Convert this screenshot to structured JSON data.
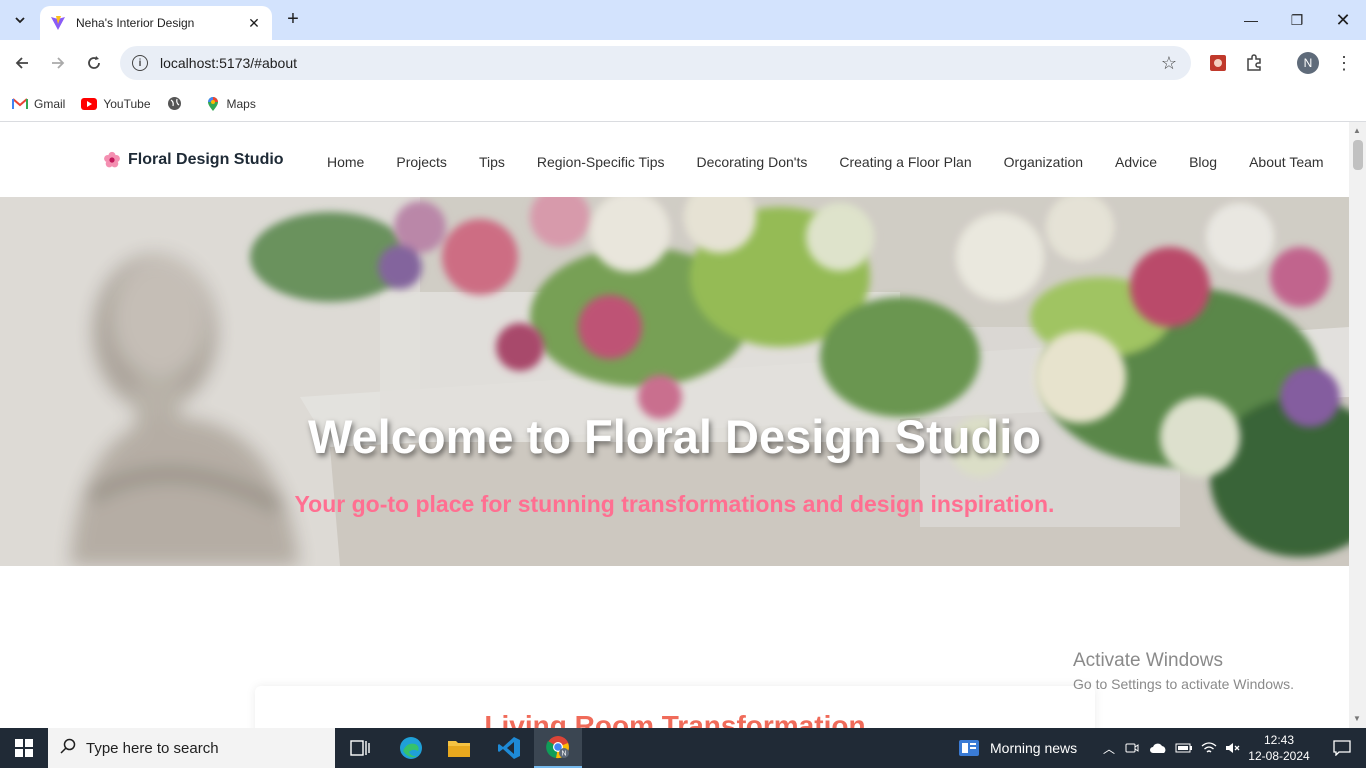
{
  "browser": {
    "tab_title": "Neha's Interior Design",
    "url": "localhost:5173/#about",
    "profile_initial": "N",
    "bookmarks": [
      {
        "label": "Gmail",
        "icon": "gmail-icon"
      },
      {
        "label": "YouTube",
        "icon": "youtube-icon"
      },
      {
        "label": "",
        "icon": "globe-icon"
      },
      {
        "label": "Maps",
        "icon": "maps-icon"
      }
    ]
  },
  "site": {
    "brand": "Floral Design Studio",
    "nav": [
      "Home",
      "Projects",
      "Tips",
      "Region-Specific Tips",
      "Decorating Don'ts",
      "Creating a Floor Plan",
      "Organization",
      "Advice",
      "Blog",
      "About Team"
    ],
    "hero_title": "Welcome to Floral Design Studio",
    "hero_subtitle": "Your go-to place for stunning transformations and design inspiration.",
    "card_title": "Living Room Transformation"
  },
  "watermark": {
    "line1": "Activate Windows",
    "line2": "Go to Settings to activate Windows."
  },
  "taskbar": {
    "search_placeholder": "Type here to search",
    "news": "Morning news",
    "time": "12:43",
    "date": "12-08-2024"
  },
  "colors": {
    "accent_pink": "#ff6f91",
    "card_title": "#f06b5a",
    "tab_strip": "#d3e3fd"
  }
}
